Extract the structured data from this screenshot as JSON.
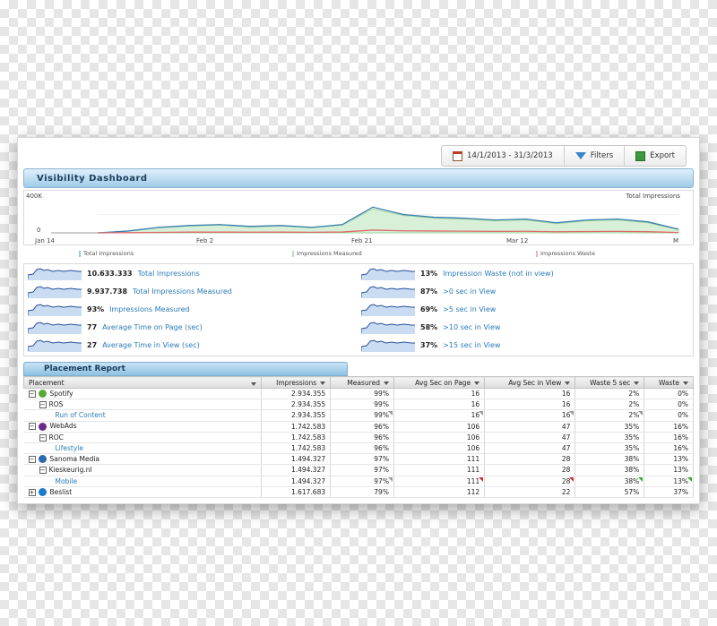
{
  "toolbar": {
    "date_range": "14/1/2013 - 31/3/2013",
    "filters_label": "Filters",
    "export_label": "Export"
  },
  "dashboard": {
    "title": "Visibility Dashboard"
  },
  "chart_data": {
    "type": "area",
    "title": "Total Impressions",
    "yticks": [
      "400K",
      "0"
    ],
    "ylim": [
      0,
      400000
    ],
    "xticks": [
      "Jan 14",
      "Feb 2",
      "Feb 21",
      "Mar 12",
      "M"
    ],
    "legend": [
      "Total Impressions",
      "Impressions Measured",
      "Impressions Waste"
    ],
    "colors": {
      "total": "#3a7fb0",
      "measured": "#9ed69e",
      "waste": "#e06a6a"
    },
    "x": [
      0,
      4,
      8,
      12,
      16,
      20,
      24,
      28,
      32,
      36,
      40,
      44,
      48,
      52,
      56,
      60,
      64,
      68,
      72,
      76
    ],
    "series": [
      {
        "name": "Total Impressions",
        "values": [
          0,
          20000,
          60000,
          80000,
          90000,
          70000,
          80000,
          60000,
          90000,
          280000,
          200000,
          170000,
          160000,
          140000,
          150000,
          110000,
          140000,
          150000,
          120000,
          40000
        ]
      },
      {
        "name": "Impressions Measured",
        "values": [
          0,
          20000,
          55000,
          75000,
          85000,
          65000,
          75000,
          55000,
          85000,
          260000,
          190000,
          160000,
          150000,
          130000,
          140000,
          100000,
          130000,
          140000,
          110000,
          35000
        ]
      },
      {
        "name": "Impressions Waste",
        "values": [
          0,
          2000,
          5000,
          8000,
          8000,
          7000,
          8000,
          6000,
          9000,
          30000,
          22000,
          20000,
          18000,
          16000,
          17000,
          12000,
          15000,
          16000,
          13000,
          4000
        ]
      }
    ]
  },
  "kpis_left": [
    {
      "value": "10.633.333",
      "label": "Total Impressions"
    },
    {
      "value": "9.937.738",
      "label": "Total Impressions Measured"
    },
    {
      "value": "93%",
      "label": "Impressions Measured"
    },
    {
      "value": "77",
      "label": "Average Time on Page (sec)"
    },
    {
      "value": "27",
      "label": "Average Time in View (sec)"
    }
  ],
  "kpis_right": [
    {
      "value": "13%",
      "label": "Impression Waste (not in view)"
    },
    {
      "value": "87%",
      "label": ">0 sec in View"
    },
    {
      "value": "69%",
      "label": ">5 sec in View"
    },
    {
      "value": "58%",
      "label": ">10 sec in View"
    },
    {
      "value": "37%",
      "label": ">15 sec in View"
    }
  ],
  "placement_report": {
    "title": "Placement Report",
    "columns": [
      "Placement",
      "Impressions",
      "Measured",
      "Avg Sec on Page",
      "Avg Sec in View",
      "Waste 5 sec",
      "Waste"
    ],
    "rows": [
      {
        "name": "Spotify",
        "level": 1,
        "toggle": "−",
        "logo": "#5aa83a",
        "cells": [
          "2.934.355",
          "99%",
          "16",
          "16",
          "2%",
          "0%"
        ]
      },
      {
        "name": "ROS",
        "level": 2,
        "toggle": "−",
        "cells": [
          "2.934.355",
          "99%",
          "16",
          "16",
          "2%",
          "0%"
        ]
      },
      {
        "name": "Run of Content",
        "level": 3,
        "cells": [
          "2.934.355",
          "99%",
          "16",
          "16",
          "2%",
          "0%"
        ]
      },
      {
        "name": "WebAds",
        "level": 1,
        "toggle": "−",
        "logo": "#6a2a8a",
        "cells": [
          "1.742.583",
          "96%",
          "106",
          "47",
          "35%",
          "16%"
        ]
      },
      {
        "name": "ROC",
        "level": 2,
        "toggle": "−",
        "cells": [
          "1.742.583",
          "96%",
          "106",
          "47",
          "35%",
          "16%"
        ]
      },
      {
        "name": "Lifestyle",
        "level": 3,
        "cells": [
          "1.742.583",
          "96%",
          "106",
          "47",
          "35%",
          "16%"
        ]
      },
      {
        "name": "Sanoma Media",
        "level": 1,
        "toggle": "−",
        "logo": "#2a6ab0",
        "cells": [
          "1.494.327",
          "97%",
          "111",
          "28",
          "38%",
          "13%"
        ]
      },
      {
        "name": "Kieskeurig.nl",
        "level": 2,
        "toggle": "−",
        "cells": [
          "1.494.327",
          "97%",
          "111",
          "28",
          "38%",
          "13%"
        ]
      },
      {
        "name": "Mobile",
        "level": 3,
        "cells": [
          "1.494.327",
          "97%",
          "111",
          "28",
          "38%",
          "13%"
        ]
      },
      {
        "name": "Beslist",
        "level": 1,
        "toggle": "+",
        "logo": "#1a7ad0",
        "cells": [
          "1.617.683",
          "79%",
          "112",
          "22",
          "57%",
          "37%"
        ]
      }
    ]
  }
}
